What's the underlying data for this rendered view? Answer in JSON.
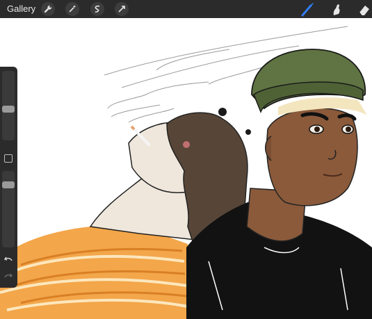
{
  "topbar": {
    "gallery_label": "Gallery",
    "left_tools": [
      "wrench-icon",
      "magic-wand-icon",
      "selection-icon",
      "transform-icon"
    ],
    "right_tools": [
      "brush-icon",
      "smudge-icon",
      "eraser-icon"
    ],
    "active_tool": "brush-icon",
    "accent_color": "#2f7df6"
  },
  "sidebar": {
    "brush_size_level": 0.55,
    "opacity_level": 0.15
  },
  "colors": {
    "bar_bg": "#2b2b2b",
    "beanie": "#5f7442",
    "skin_dark": "#8a5a3b",
    "skin_light": "#efe7dc",
    "hair_brown": "#574638",
    "shirt_orange": "#f3a64a",
    "shirt_black": "#121212"
  }
}
